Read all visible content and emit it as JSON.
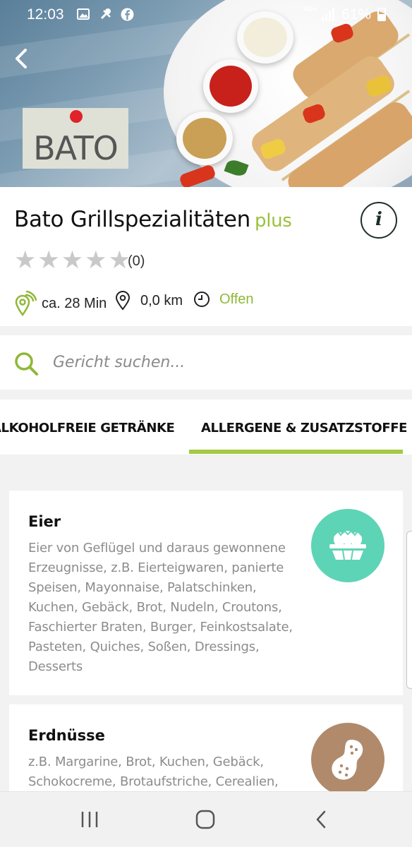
{
  "status_bar": {
    "time": "12:03",
    "network": "4G+",
    "battery": "61%",
    "icons": [
      "image-icon",
      "tools-icon",
      "facebook-icon",
      "signal-icon",
      "battery-icon"
    ]
  },
  "header": {
    "back_icon": "chevron-left-icon",
    "logo_text": "BATO"
  },
  "restaurant": {
    "name": "Bato Grillspezialitäten",
    "tag": "plus",
    "info_icon_text": "i",
    "rating_count": "(0)",
    "stars_filled": 0,
    "stars_total": 5,
    "delivery_time": "ca. 28 Min",
    "distance": "0,0 km",
    "status": "Offen"
  },
  "search": {
    "placeholder": "Gericht suchen..."
  },
  "tabs": [
    {
      "label": "ALKOHOLFREIE GETRÄNKE",
      "active": false
    },
    {
      "label": "ALLERGENE & ZUSATZSTOFFE",
      "active": true
    }
  ],
  "allergens": [
    {
      "name": "Eier",
      "description": "Eier von Geflügel und daraus gewonnene Erzeugnisse, z.B. Eierteigwaren, panierte Speisen, Mayonnaise, Palatschinken, Kuchen, Gebäck, Brot, Nudeln, Croutons, Faschierter Braten, Burger, Feinkostsalate, Pasteten, Quiches, Soßen, Dressings, Desserts",
      "icon": "eggs-icon",
      "color": "#5dd4b6"
    },
    {
      "name": "Erdnüsse",
      "description": "z.B. Margarine, Brot, Kuchen, Gebäck, Schokocreme, Brotaufstriche, Cerealien,",
      "icon": "peanut-icon",
      "color": "#b08a6b"
    }
  ],
  "colors": {
    "accent": "#9bc13c",
    "tab_indicator": "#a4c944",
    "dark": "#1e2e2a"
  },
  "nav": {
    "icons": [
      "recent-apps-icon",
      "home-icon",
      "back-icon"
    ]
  }
}
